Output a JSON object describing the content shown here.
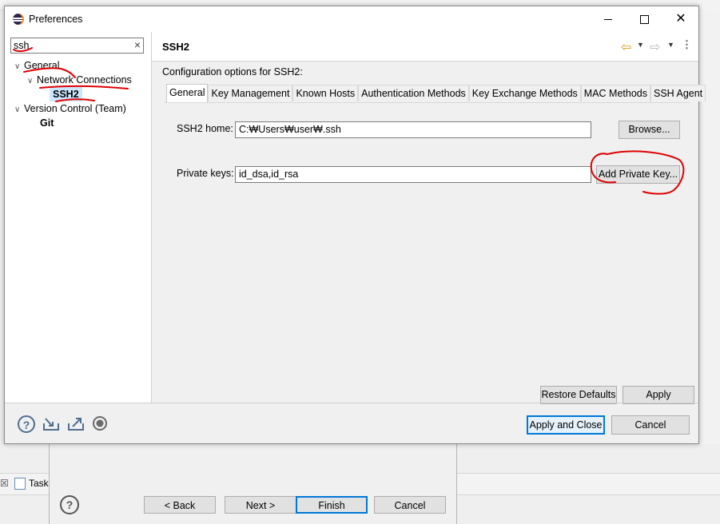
{
  "wizard": {
    "back_label": "< Back",
    "next_label": "Next >",
    "finish_label": "Finish",
    "cancel_label": "Cancel"
  },
  "background": {
    "task_tab_label": "Task"
  },
  "dialog": {
    "title": "Preferences",
    "filter_value": "ssh",
    "tree": {
      "general": "General",
      "network_connections": "Network Connections",
      "ssh2": "SSH2",
      "version_control": "Version Control (Team)",
      "git": "Git"
    },
    "page": {
      "title": "SSH2",
      "config_label": "Configuration options for SSH2:",
      "tabs": [
        "General",
        "Key Management",
        "Known Hosts",
        "Authentication Methods",
        "Key Exchange Methods",
        "MAC Methods",
        "SSH Agent"
      ],
      "ssh_home_label": "SSH2 home:",
      "ssh_home_value": "C:₩Users₩user₩.ssh",
      "browse_label": "Browse...",
      "private_keys_label": "Private keys:",
      "private_keys_value": "id_dsa,id_rsa",
      "add_private_key_label": "Add Private Key...",
      "restore_defaults_label": "Restore Defaults",
      "apply_label": "Apply"
    },
    "buttons": {
      "apply_and_close": "Apply and Close",
      "cancel": "Cancel"
    }
  },
  "annotation_color": "#e00000",
  "selection_color": "#cce8ff",
  "default_button_border": "#0078d7"
}
